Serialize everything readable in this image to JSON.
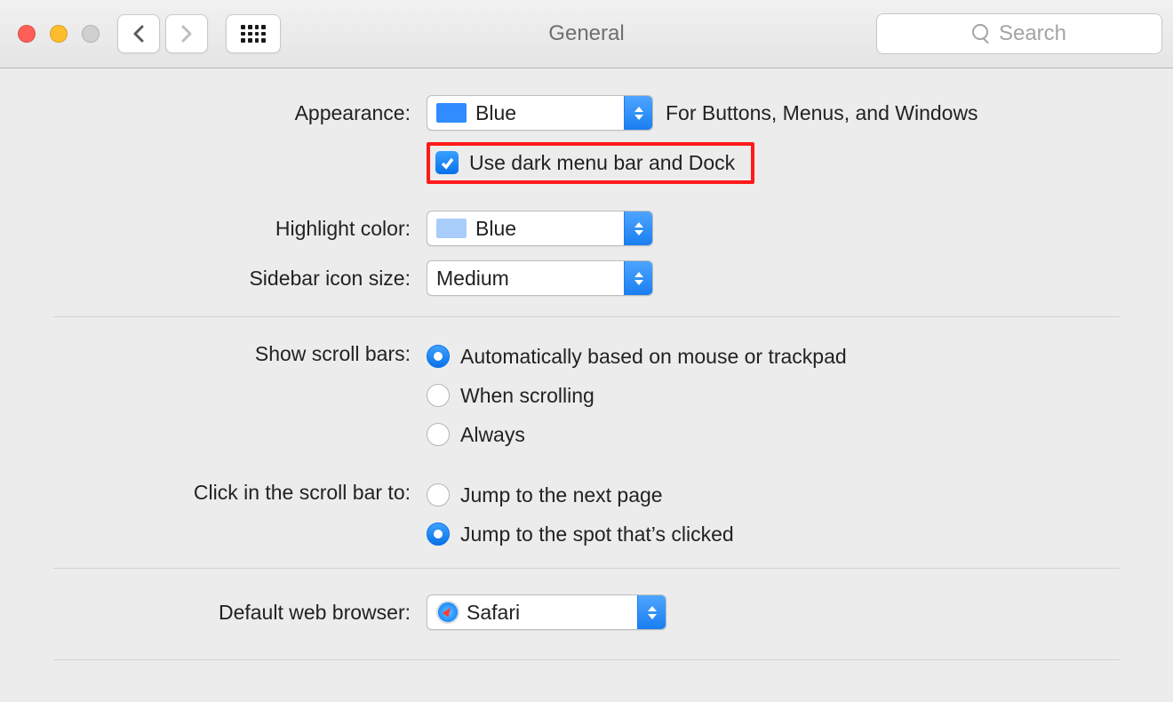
{
  "window": {
    "title": "General"
  },
  "search": {
    "placeholder": "Search"
  },
  "rows": {
    "appearance": {
      "label": "Appearance:",
      "value": "Blue",
      "swatch": "#2f8dff",
      "hint": "For Buttons, Menus, and Windows"
    },
    "darkMode": {
      "label": "Use dark menu bar and Dock",
      "checked": true
    },
    "highlight": {
      "label": "Highlight color:",
      "value": "Blue",
      "swatch": "#a8cdfa"
    },
    "sidebarIcon": {
      "label": "Sidebar icon size:",
      "value": "Medium"
    },
    "scrollbars": {
      "label": "Show scroll bars:",
      "options": [
        {
          "label": "Automatically based on mouse or trackpad",
          "selected": true
        },
        {
          "label": "When scrolling",
          "selected": false
        },
        {
          "label": "Always",
          "selected": false
        }
      ]
    },
    "clickScroll": {
      "label": "Click in the scroll bar to:",
      "options": [
        {
          "label": "Jump to the next page",
          "selected": false
        },
        {
          "label": "Jump to the spot that’s clicked",
          "selected": true
        }
      ]
    },
    "defaultBrowser": {
      "label": "Default web browser:",
      "value": "Safari"
    }
  }
}
